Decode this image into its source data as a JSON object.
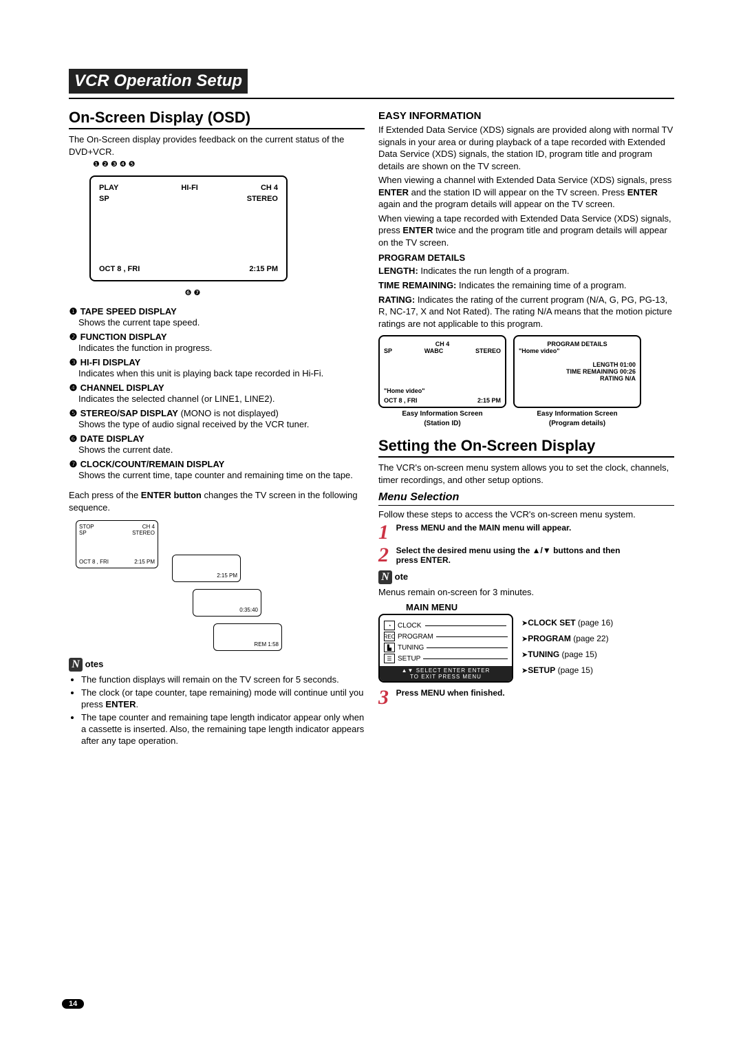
{
  "title_bar": "VCR Operation Setup",
  "left": {
    "osd_heading": "On-Screen Display (OSD)",
    "osd_intro": "The On-Screen display provides feedback on the current status of the DVD+VCR.",
    "osd_display": {
      "play": "PLAY",
      "hifi": "HI-FI",
      "ch": "CH  4",
      "sp": "SP",
      "stereo": "STEREO",
      "date": "OCT  8 ,  FRI",
      "time": "2:15 PM"
    },
    "markers_top": "❶  ❷          ❸           ❹   ❺",
    "markers_bottom": "❻                 ❼",
    "items": [
      {
        "num": "❶",
        "title": "TAPE SPEED DISPLAY",
        "desc": "Shows the current tape speed."
      },
      {
        "num": "❷",
        "title": "FUNCTION DISPLAY",
        "desc": "Indicates the function in progress."
      },
      {
        "num": "❸",
        "title": "HI-FI DISPLAY",
        "desc": "Indicates when this unit is playing back tape recorded in Hi-Fi."
      },
      {
        "num": "❹",
        "title": "CHANNEL DISPLAY",
        "desc": "Indicates the selected channel (or LINE1, LINE2)."
      },
      {
        "num": "❺",
        "title": "STEREO/SAP DISPLAY",
        "inline": " (MONO is not displayed)",
        "desc": "Shows the type of audio signal received by the VCR tuner."
      },
      {
        "num": "❻",
        "title": "DATE DISPLAY",
        "desc": "Shows the current date."
      },
      {
        "num": "❼",
        "title": "CLOCK/COUNT/REMAIN DISPLAY",
        "desc": "Shows the current time, tape counter and remaining time on the tape."
      }
    ],
    "enter_note_pre": "Each press of the ",
    "enter_note_bold": "ENTER button",
    "enter_note_post": " changes the TV screen in the following sequence.",
    "sequence_box": {
      "stop": "STOP",
      "sp": "SP",
      "ch": "CH  4",
      "stereo": "STEREO",
      "date": "OCT  8 ,  FRI",
      "time": "2:15 PM",
      "b2": "2:15 PM",
      "b3": "0:35:40",
      "b4": "REM 1:58"
    },
    "notes_heading": "otes",
    "notes": [
      "The function displays will remain on the TV screen for 5 seconds.",
      "The clock (or tape counter, tape remaining) mode will continue until you press ENTER.",
      "The tape counter and remaining tape length indicator appear only when a cassette is inserted. Also, the remaining tape length indicator appears after any tape operation."
    ]
  },
  "right": {
    "easy_heading": "EASY INFORMATION",
    "easy_p1": "If Extended Data Service (XDS) signals are provided along with normal TV signals in your area or during playback of a tape recorded with Extended Data Service (XDS) signals, the station ID, program title and program details are shown on the TV screen.",
    "easy_p2_pre": "When viewing a channel with Extended Data Service (XDS) signals, press ",
    "easy_p2_mid": " and the station ID will appear on the TV screen. Press ",
    "easy_p2_post": " again and the program details will appear on the TV screen.",
    "easy_p3_pre": "When viewing a tape recorded with Extended  Data Service (XDS) signals, press ",
    "easy_p3_post": " twice and the program title and program details will appear on the TV screen.",
    "enter": "ENTER",
    "program_details_heading": "PROGRAM DETAILS",
    "pd_length_label": "LENGTH:",
    "pd_length": " Indicates the run length of a program.",
    "pd_time_label": "TIME REMAINING:",
    "pd_time": " Indicates the remaining time of a program.",
    "pd_rating_label": "RATING:",
    "pd_rating": " Indicates the rating of the current program (N/A, G, PG, PG-13, R, NC-17, X and Not Rated). The rating N/A means that the motion picture ratings are not applicable to this program.",
    "screen1": {
      "ch": "CH  4",
      "sp": "SP",
      "wabc": "WABC",
      "stereo": "STEREO",
      "home": "\"Home video\"",
      "date": "OCT   8 , FRI",
      "time": "2:15 PM",
      "caption1": "Easy Information Screen",
      "caption2": "(Station ID)"
    },
    "screen2": {
      "title": "PROGRAM DETAILS",
      "home": "\"Home video\"",
      "len_l": "LENGTH",
      "len_v": "01:00",
      "tr_l": "TIME REMAINING",
      "tr_v": "00:26",
      "rt_l": "RATING",
      "rt_v": "N/A",
      "caption1": "Easy Information Screen",
      "caption2": "(Program details)"
    },
    "setting_heading": "Setting the On-Screen Display",
    "setting_intro": "The VCR's on-screen menu system allows you to set the clock, channels, timer recordings, and other setup options.",
    "menu_sel_heading": "Menu Selection",
    "menu_sel_intro": "Follow these steps to access the VCR's on-screen menu system.",
    "step1": "Press MENU and the MAIN menu will appear.",
    "step2": "Select the desired menu using the ▲/▼ buttons and then press ENTER.",
    "note_heading": "ote",
    "note_text": "Menus remain on-screen for 3 minutes.",
    "main_menu_label": "MAIN MENU",
    "menu": {
      "clock": "CLOCK",
      "program": "PROGRAM",
      "tuning": "TUNING",
      "setup": "SETUP",
      "bottom": "▲▼ SELECT ENTER ENTER",
      "bottom2": "TO  EXIT PRESS  MENU"
    },
    "refs": {
      "clock_b": "CLOCK SET",
      "clock_p": " (page 16)",
      "program_b": "PROGRAM",
      "program_p": " (page 22)",
      "tuning_b": "TUNING",
      "tuning_p": " (page 15)",
      "setup_b": "SETUP",
      "setup_p": " (page 15)"
    },
    "step3": "Press MENU when finished."
  },
  "page_number": "14"
}
